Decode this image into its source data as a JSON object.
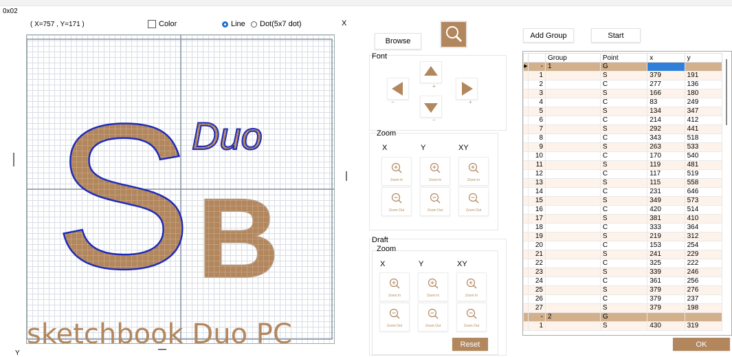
{
  "window": {
    "title": "0x02",
    "close_glyph": "X"
  },
  "coords": {
    "text": "( X=757 , Y=171 )"
  },
  "options": {
    "color_label": "Color",
    "line_label": "Line",
    "dot_label": "Dot(5x7 dot)",
    "selected": "Line"
  },
  "canvas": {
    "axis_y_label": "Y"
  },
  "buttons": {
    "browse": "Browse",
    "add_group": "Add Group",
    "start": "Start",
    "reset": "Reset",
    "ok": "OK"
  },
  "font_group": {
    "title": "Font",
    "up_sign": "+",
    "left_sign": "−",
    "right_sign": "+",
    "down_sign": "−"
  },
  "zoom_group": {
    "title": "Zoom",
    "cols": [
      "X",
      "Y",
      "XY"
    ],
    "zoom_in": "Zoom In",
    "zoom_out": "Zoom Out"
  },
  "draft_group": {
    "title": "Draft",
    "sub_title": "Zoom",
    "cols": [
      "X",
      "Y",
      "XY"
    ]
  },
  "table": {
    "columns": [
      "Group",
      "Point",
      "x",
      "y"
    ],
    "rows": [
      {
        "idx": "-",
        "group": "1",
        "point": "G",
        "x": "",
        "y": "",
        "kind": "group",
        "current": true
      },
      {
        "idx": "1",
        "group": "",
        "point": "S",
        "x": "379",
        "y": "191"
      },
      {
        "idx": "2",
        "group": "",
        "point": "C",
        "x": "277",
        "y": "136"
      },
      {
        "idx": "3",
        "group": "",
        "point": "S",
        "x": "166",
        "y": "180"
      },
      {
        "idx": "4",
        "group": "",
        "point": "C",
        "x": "83",
        "y": "249"
      },
      {
        "idx": "5",
        "group": "",
        "point": "S",
        "x": "134",
        "y": "347"
      },
      {
        "idx": "6",
        "group": "",
        "point": "C",
        "x": "214",
        "y": "412"
      },
      {
        "idx": "7",
        "group": "",
        "point": "S",
        "x": "292",
        "y": "441"
      },
      {
        "idx": "8",
        "group": "",
        "point": "C",
        "x": "343",
        "y": "518"
      },
      {
        "idx": "9",
        "group": "",
        "point": "S",
        "x": "263",
        "y": "533"
      },
      {
        "idx": "10",
        "group": "",
        "point": "C",
        "x": "170",
        "y": "540"
      },
      {
        "idx": "11",
        "group": "",
        "point": "S",
        "x": "119",
        "y": "481"
      },
      {
        "idx": "12",
        "group": "",
        "point": "C",
        "x": "117",
        "y": "519"
      },
      {
        "idx": "13",
        "group": "",
        "point": "S",
        "x": "115",
        "y": "558"
      },
      {
        "idx": "14",
        "group": "",
        "point": "C",
        "x": "231",
        "y": "646"
      },
      {
        "idx": "15",
        "group": "",
        "point": "S",
        "x": "349",
        "y": "573"
      },
      {
        "idx": "16",
        "group": "",
        "point": "C",
        "x": "420",
        "y": "514"
      },
      {
        "idx": "17",
        "group": "",
        "point": "S",
        "x": "381",
        "y": "410"
      },
      {
        "idx": "18",
        "group": "",
        "point": "C",
        "x": "333",
        "y": "364"
      },
      {
        "idx": "19",
        "group": "",
        "point": "S",
        "x": "219",
        "y": "312"
      },
      {
        "idx": "20",
        "group": "",
        "point": "C",
        "x": "153",
        "y": "254"
      },
      {
        "idx": "21",
        "group": "",
        "point": "S",
        "x": "241",
        "y": "229"
      },
      {
        "idx": "22",
        "group": "",
        "point": "C",
        "x": "325",
        "y": "222"
      },
      {
        "idx": "23",
        "group": "",
        "point": "S",
        "x": "339",
        "y": "246"
      },
      {
        "idx": "24",
        "group": "",
        "point": "C",
        "x": "361",
        "y": "256"
      },
      {
        "idx": "25",
        "group": "",
        "point": "S",
        "x": "379",
        "y": "276"
      },
      {
        "idx": "26",
        "group": "",
        "point": "C",
        "x": "379",
        "y": "237"
      },
      {
        "idx": "27",
        "group": "",
        "point": "S",
        "x": "379",
        "y": "198"
      },
      {
        "idx": "-",
        "group": "2",
        "point": "G",
        "x": "",
        "y": "",
        "kind": "group"
      },
      {
        "idx": "1",
        "group": "",
        "point": "S",
        "x": "430",
        "y": "319"
      }
    ]
  },
  "artwork": {
    "big_s": "S",
    "big_b": "B",
    "duo": "Duo",
    "footer_text": "sketchbook Duo PC"
  },
  "colors": {
    "accent": "#b2875e",
    "outline": "#1f2bb8",
    "selection": "#2f7fd8"
  },
  "icons": {
    "search": "magnifier-icon",
    "zoom_in": "zoom-in-icon",
    "zoom_out": "zoom-out-icon"
  }
}
